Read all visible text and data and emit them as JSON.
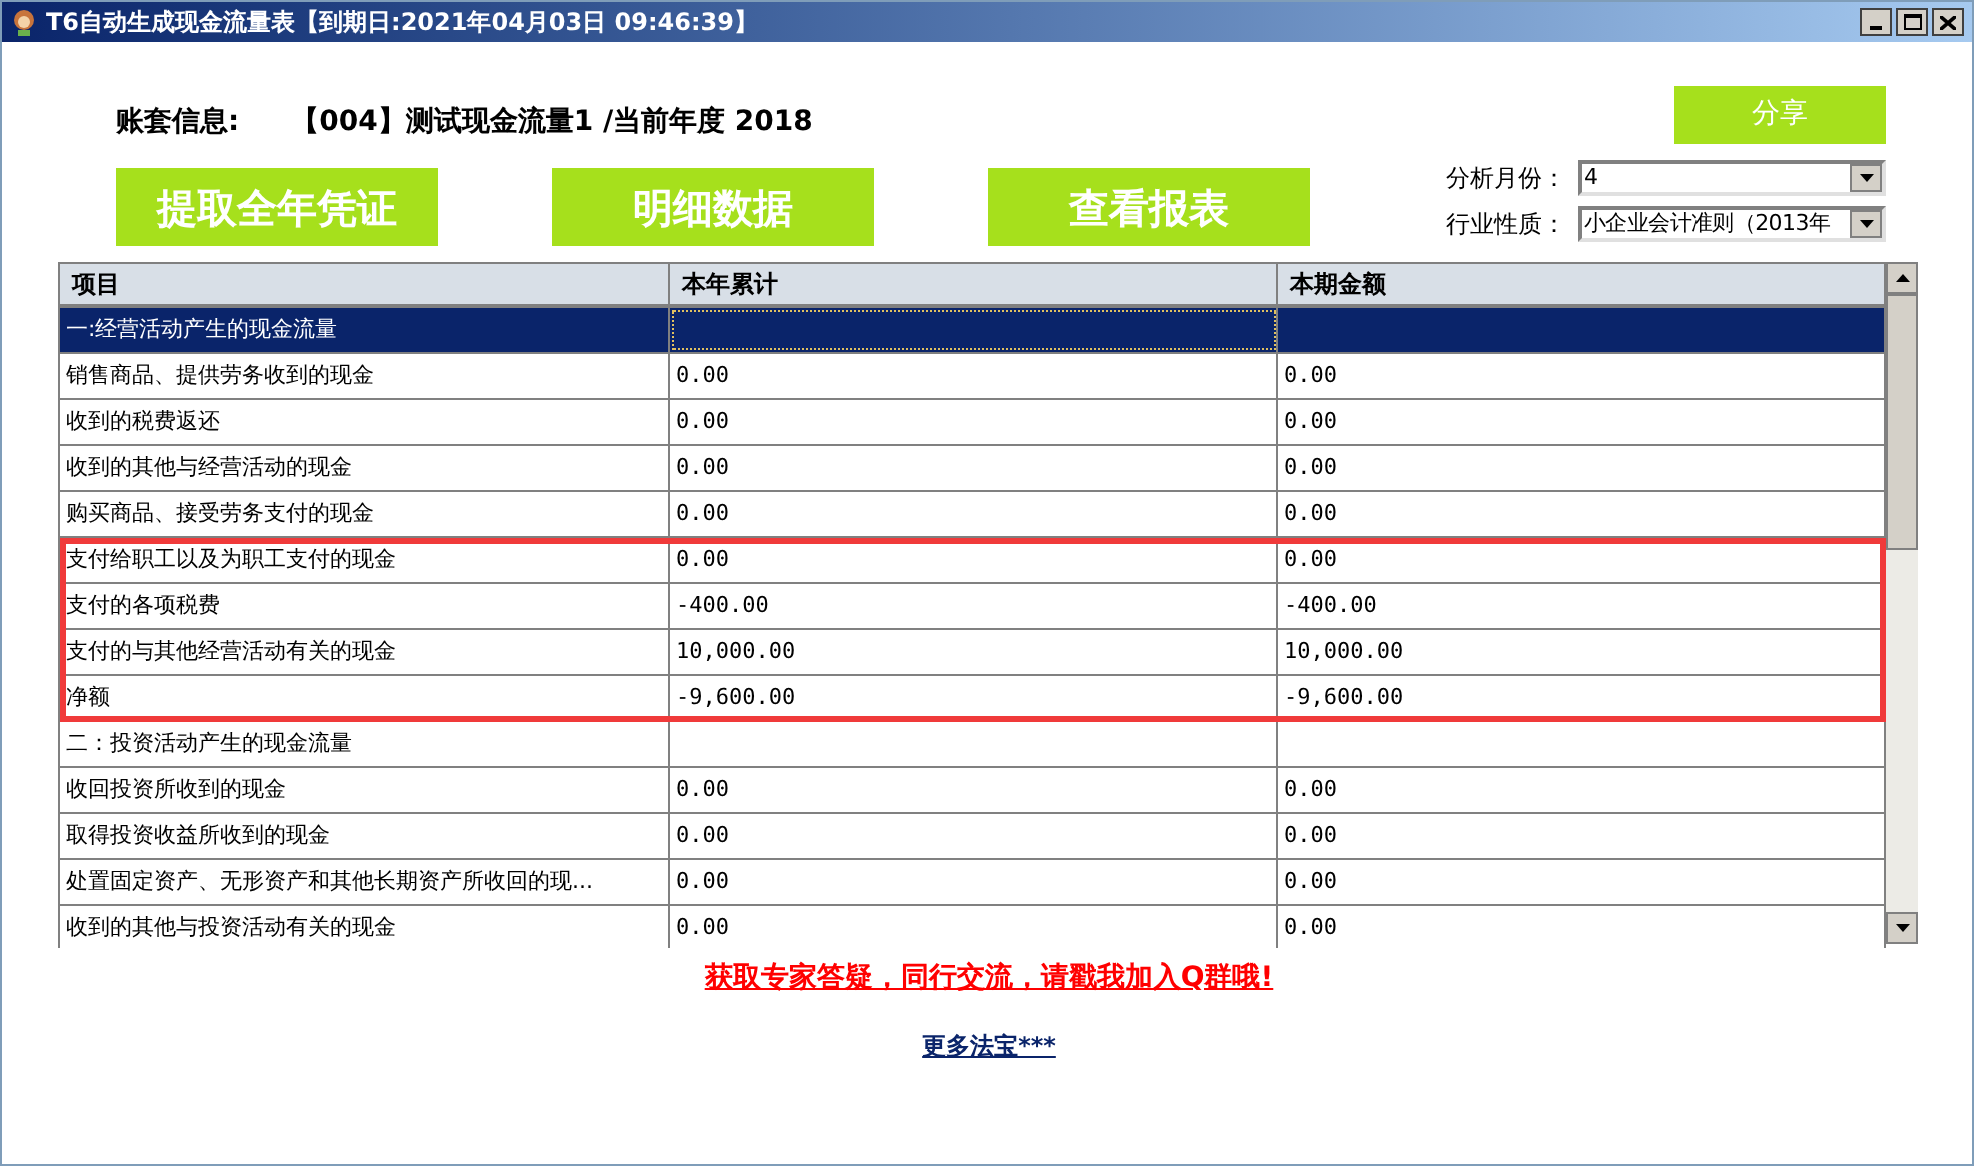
{
  "window": {
    "title": "T6自动生成现金流量表【到期日:2021年04月03日 09:46:39】"
  },
  "account": {
    "label": "账套信息:",
    "value": "【004】测试现金流量1 /当前年度 2018"
  },
  "share_button": "分享",
  "action_buttons": [
    "提取全年凭证",
    "明细数据",
    "查看报表"
  ],
  "filters": [
    {
      "label": "分析月份：",
      "value": "4"
    },
    {
      "label": "行业性质：",
      "value": "小企业会计准则（2013年"
    }
  ],
  "table": {
    "columns": [
      "项目",
      "本年累计",
      "本期金额"
    ],
    "rows": [
      {
        "item": "一:经营活动产生的现金流量",
        "selected": true,
        "highlighted": false
      },
      {
        "item": "销售商品、提供劳务收到的现金",
        "ytd": "0.00",
        "period": "0.00",
        "selected": false,
        "highlighted": false
      },
      {
        "item": "收到的税费返还",
        "ytd": "0.00",
        "period": "0.00",
        "selected": false,
        "highlighted": false
      },
      {
        "item": "收到的其他与经营活动的现金",
        "ytd": "0.00",
        "period": "0.00",
        "selected": false,
        "highlighted": false
      },
      {
        "item": "购买商品、接受劳务支付的现金",
        "ytd": "0.00",
        "period": "0.00",
        "selected": false,
        "highlighted": false
      },
      {
        "item": "支付给职工以及为职工支付的现金",
        "ytd": "0.00",
        "period": "0.00",
        "selected": false,
        "highlighted": true
      },
      {
        "item": "支付的各项税费",
        "ytd": "-400.00",
        "period": "-400.00",
        "selected": false,
        "highlighted": true
      },
      {
        "item": "支付的与其他经营活动有关的现金",
        "ytd": "10,000.00",
        "period": "10,000.00",
        "selected": false,
        "highlighted": true
      },
      {
        "item": "净额",
        "ytd": "-9,600.00",
        "period": "-9,600.00",
        "selected": false,
        "highlighted": true
      },
      {
        "item": "二：投资活动产生的现金流量",
        "selected": false,
        "highlighted": false
      },
      {
        "item": "收回投资所收到的现金",
        "ytd": "0.00",
        "period": "0.00",
        "selected": false,
        "highlighted": false
      },
      {
        "item": "取得投资收益所收到的现金",
        "ytd": "0.00",
        "period": "0.00",
        "selected": false,
        "highlighted": false
      },
      {
        "item": "处置固定资产、无形资产和其他长期资产所收回的现...",
        "ytd": "0.00",
        "period": "0.00",
        "selected": false,
        "highlighted": false
      },
      {
        "item": "收到的其他与投资活动有关的现金",
        "ytd": "0.00",
        "period": "0.00",
        "selected": false,
        "highlighted": false
      }
    ]
  },
  "promo_link": "获取专家答疑，同行交流，请戳我加入Q群哦!",
  "more_link": "更多法宝***"
}
